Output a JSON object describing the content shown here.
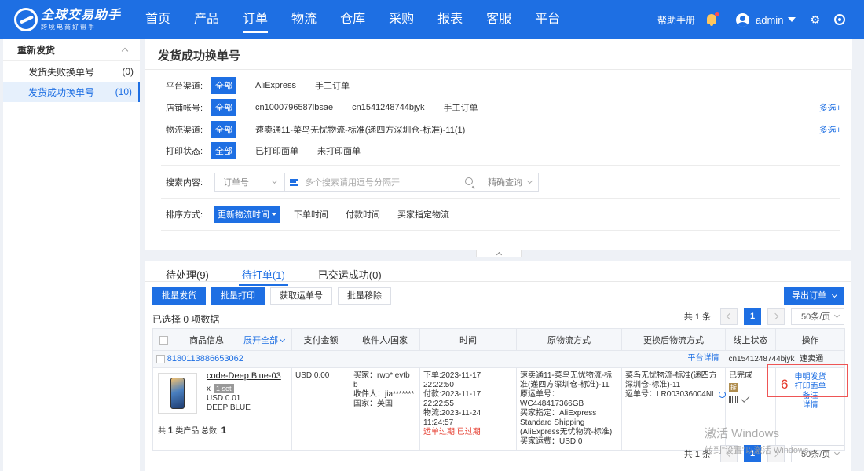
{
  "app": {
    "logo_title": "全球交易助手",
    "logo_sub": "跨境电商好帮手",
    "nav": [
      "首页",
      "产品",
      "订单",
      "物流",
      "仓库",
      "采购",
      "报表",
      "客服",
      "平台"
    ],
    "active_nav": "订单",
    "help": "帮助手册",
    "username": "admin"
  },
  "sidebar": {
    "group": "重新发货",
    "items": [
      {
        "label": "发货失败换单号",
        "count": "(0)"
      },
      {
        "label": "发货成功换单号",
        "count": "(10)"
      }
    ]
  },
  "page": {
    "title": "发货成功换单号"
  },
  "filters": {
    "platform": {
      "label": "平台渠道:",
      "all": "全部",
      "options": [
        "AliExpress",
        "手工订单"
      ]
    },
    "shop": {
      "label": "店铺帐号:",
      "all": "全部",
      "options": [
        "cn1000796587lbsae",
        "cn1541248744bjyk",
        "手工订单"
      ],
      "more": "多选+"
    },
    "logistics": {
      "label": "物流渠道:",
      "all": "全部",
      "options": [
        "速卖通11-菜鸟无忧物流-标准(递四方深圳仓-标准)-11(1)"
      ],
      "more": "多选+"
    },
    "print": {
      "label": "打印状态:",
      "all": "全部",
      "options": [
        "已打印面单",
        "未打印面单"
      ]
    },
    "search": {
      "label": "搜索内容:",
      "type": "订单号",
      "placeholder": "多个搜索请用逗号分隔开",
      "mode": "精确查询"
    },
    "sort": {
      "label": "排序方式:",
      "selected": "更新物流时间",
      "options": [
        "下单时间",
        "付款时间",
        "买家指定物流"
      ]
    }
  },
  "orders": {
    "tabs": [
      "待处理(9)",
      "待打单(1)",
      "已交运成功(0)"
    ],
    "active_tab": 1,
    "buttons": {
      "batch_ship": "批量发货",
      "batch_print": "批量打印",
      "get_tracking": "获取运单号",
      "batch_remove": "批量移除",
      "export": "导出订单"
    },
    "selected_info": "已选择 0 项数据",
    "pager": {
      "total": "共 1 条",
      "page": "1",
      "per_page": "50条/页"
    },
    "columns": {
      "product": "商品信息",
      "expand": "展开全部",
      "amount": "支付金额",
      "receiver": "收件人/国家",
      "time": "时间",
      "orig_logistics": "原物流方式",
      "new_logistics": "更换后物流方式",
      "status": "线上状态",
      "ops": "操作"
    },
    "order": {
      "order_no": "8180113886653062",
      "platform_detail": "平台详情",
      "shop": "cn1541248744bjyk",
      "channel": "速卖通",
      "product_code": "code-Deep Blue-03",
      "qty_x": "x",
      "qty": "1 set",
      "price": "USD 0.01",
      "variant": "DEEP BLUE",
      "foot_prefix": "共",
      "foot_kinds": "1",
      "foot_mid": "类产品  总数:",
      "foot_total": "1",
      "amount": "USD 0.00",
      "buyer": "买家：rwo* evtb b",
      "receiver": "收件人：jia*******",
      "country": "国家：英国",
      "t_order": "下单:2023-11-17 22:22:50",
      "t_pay": "付款:2023-11-17 22:22:55",
      "t_logistics": "物流:2023-11-24 11:24:57",
      "t_warning": "运单过期:已过期",
      "orig_logistics": "速卖通11-菜鸟无忧物流-标准(递四方深圳仓-标准)-11",
      "orig_tracking": "原运单号：WC448417366GB",
      "buyer_specified": "买家指定：AliExpress Standard Shipping (AliExpress无忧物流-标准)",
      "buyer_freight": "买家运费：USD 0",
      "new_logistics": "菜鸟无忧物流-标准(递四方深圳仓-标准)-11",
      "new_tracking": "运单号：LR003036004NL",
      "status": "已完成",
      "chai": "拆",
      "ops": [
        "申明发货",
        "打印面单",
        "备注",
        "详情"
      ]
    },
    "step_number": "6"
  },
  "watermark": {
    "line1": "激活 Windows",
    "line2": "转到\"设置\"以激活 Windows。"
  }
}
